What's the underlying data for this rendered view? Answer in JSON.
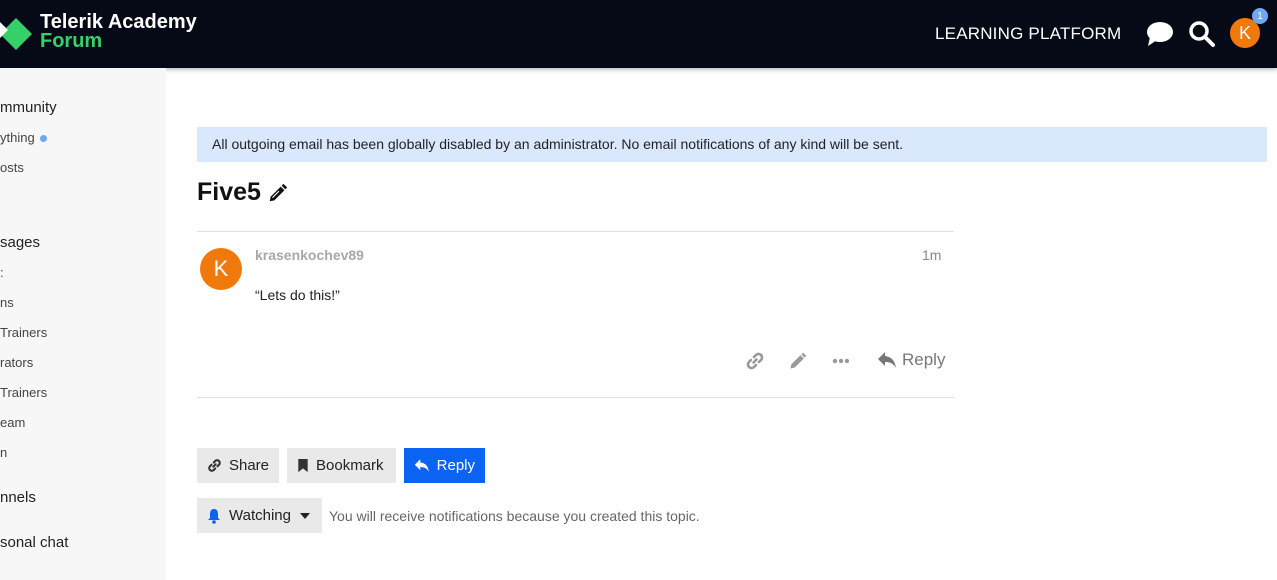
{
  "header": {
    "logo_line1": "Telerik Academy",
    "logo_line2": "Forum",
    "platform_link": "LEARNING PLATFORM",
    "avatar_letter": "K",
    "notification_count": "1"
  },
  "sidebar": {
    "sections": [
      {
        "label": "mmunity"
      },
      {
        "label": "sages"
      },
      {
        "label": "nnels"
      },
      {
        "label": "sonal chat"
      }
    ],
    "items": [
      {
        "label": "ything"
      },
      {
        "label": "osts"
      },
      {
        "label": ":"
      },
      {
        "label": "ns"
      },
      {
        "label": "Trainers"
      },
      {
        "label": "rators"
      },
      {
        "label": "Trainers"
      },
      {
        "label": "eam"
      },
      {
        "label": "n"
      }
    ]
  },
  "banner": {
    "text": "All outgoing email has been globally disabled by an administrator. No email notifications of any kind will be sent."
  },
  "topic": {
    "title": "Five5"
  },
  "post": {
    "avatar_letter": "K",
    "username": "krasenkochev89",
    "age": "1m",
    "body": "“Lets do this!”",
    "reply_label": "Reply"
  },
  "footer_buttons": {
    "share": "Share",
    "bookmark": "Bookmark",
    "reply": "Reply"
  },
  "notifications": {
    "level": "Watching",
    "description": "You will receive notifications because you created this topic."
  },
  "colors": {
    "header_bg": "#050a16",
    "accent_green": "#36d06b",
    "avatar_orange": "#f0790c",
    "primary_blue": "#0b63f4",
    "banner_bg": "#d9e8fc"
  }
}
